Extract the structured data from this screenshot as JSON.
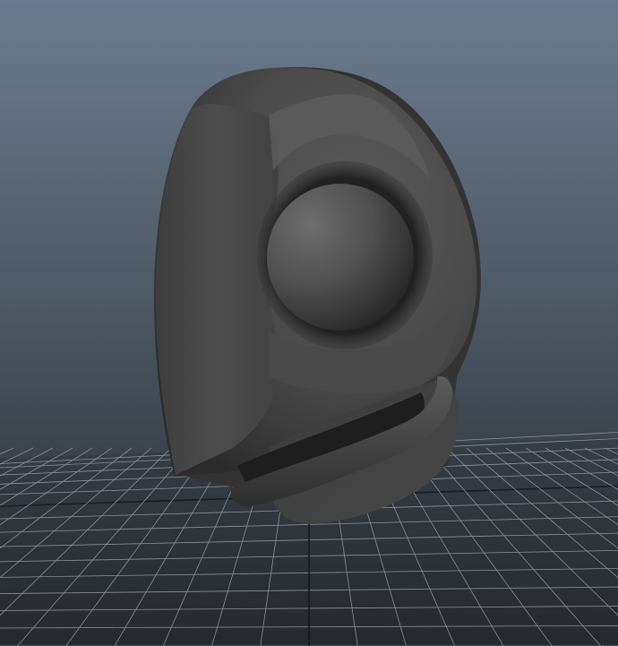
{
  "viewport": {
    "panel": "3d-perspective-viewport",
    "shading": "smooth-shaded",
    "object": "creature-head-model",
    "colors": {
      "background_top": "#6b7b8f",
      "background_bottom": "#24282c",
      "grid_line": "#9aa0a6",
      "grid_axis": "#15181b",
      "model_mid": "#4e4e4e",
      "model_light": "#6a6a6a",
      "model_dark": "#1e1e1e"
    }
  }
}
